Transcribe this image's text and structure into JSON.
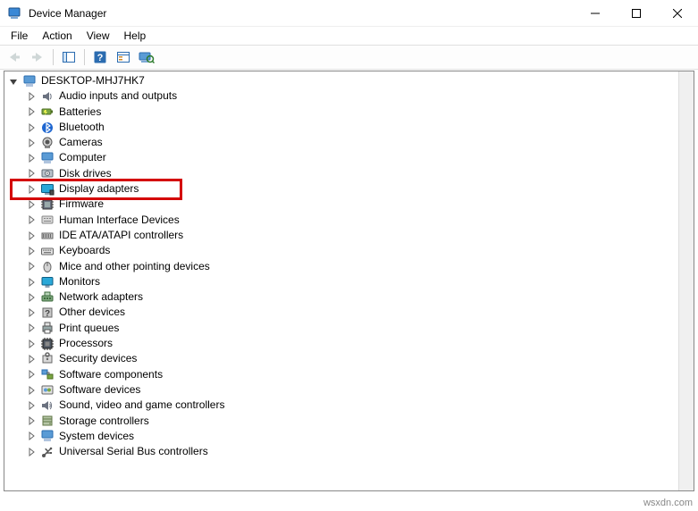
{
  "window": {
    "title": "Device Manager"
  },
  "menu": {
    "file": "File",
    "action": "Action",
    "view": "View",
    "help": "Help"
  },
  "toolbar": {
    "back": "back-icon",
    "forward": "forward-icon",
    "show_hide": "show-hide-tree-icon",
    "help": "help-icon",
    "properties": "properties-icon",
    "scan": "scan-hardware-icon"
  },
  "tree": {
    "root": "DESKTOP-MHJ7HK7",
    "nodes": [
      {
        "id": "audio",
        "label": "Audio inputs and outputs",
        "icon": "speaker-icon"
      },
      {
        "id": "batteries",
        "label": "Batteries",
        "icon": "battery-icon"
      },
      {
        "id": "bluetooth",
        "label": "Bluetooth",
        "icon": "bluetooth-icon"
      },
      {
        "id": "cameras",
        "label": "Cameras",
        "icon": "camera-icon"
      },
      {
        "id": "computer",
        "label": "Computer",
        "icon": "computer-icon"
      },
      {
        "id": "diskdrives",
        "label": "Disk drives",
        "icon": "disk-icon"
      },
      {
        "id": "display",
        "label": "Display adapters",
        "icon": "display-icon",
        "highlight": true
      },
      {
        "id": "firmware",
        "label": "Firmware",
        "icon": "chip-icon"
      },
      {
        "id": "hid",
        "label": "Human Interface Devices",
        "icon": "hid-icon"
      },
      {
        "id": "ide",
        "label": "IDE ATA/ATAPI controllers",
        "icon": "ide-icon"
      },
      {
        "id": "keyboards",
        "label": "Keyboards",
        "icon": "keyboard-icon"
      },
      {
        "id": "mice",
        "label": "Mice and other pointing devices",
        "icon": "mouse-icon"
      },
      {
        "id": "monitors",
        "label": "Monitors",
        "icon": "monitor-icon"
      },
      {
        "id": "netadapters",
        "label": "Network adapters",
        "icon": "network-icon"
      },
      {
        "id": "other",
        "label": "Other devices",
        "icon": "other-icon"
      },
      {
        "id": "printqueues",
        "label": "Print queues",
        "icon": "printer-icon"
      },
      {
        "id": "processors",
        "label": "Processors",
        "icon": "cpu-icon"
      },
      {
        "id": "security",
        "label": "Security devices",
        "icon": "security-icon"
      },
      {
        "id": "swcomponents",
        "label": "Software components",
        "icon": "sw-components-icon"
      },
      {
        "id": "swdevices",
        "label": "Software devices",
        "icon": "sw-devices-icon"
      },
      {
        "id": "sound",
        "label": "Sound, video and game controllers",
        "icon": "sound-icon"
      },
      {
        "id": "storagectrl",
        "label": "Storage controllers",
        "icon": "storage-icon"
      },
      {
        "id": "system",
        "label": "System devices",
        "icon": "system-icon"
      },
      {
        "id": "usb",
        "label": "Universal Serial Bus controllers",
        "icon": "usb-icon"
      }
    ]
  },
  "watermark": "wsxdn.com"
}
